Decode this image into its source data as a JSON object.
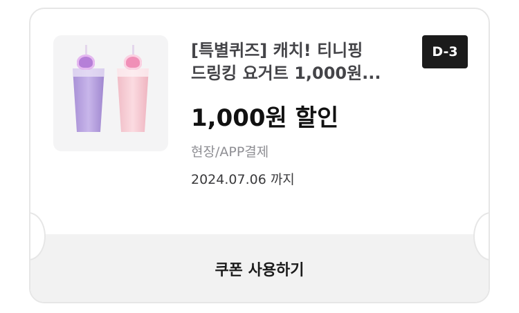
{
  "coupon": {
    "title_line1": "[특별퀴즈] 캐치! 티니핑",
    "title_line2": "드링킹 요거트 1,000원...",
    "dday_badge": "D-3",
    "discount": "1,000원 할인",
    "payment_method": "현장/APP결제",
    "expiry": "2024.07.06 까지",
    "use_button_label": "쿠폰 사용하기"
  },
  "colors": {
    "badge_bg": "#1b1b1b",
    "button_bg": "#f2f2f2",
    "purple_drink": "#b8a2de",
    "pink_drink": "#f6c9d1"
  },
  "icons": {
    "product_image": "two-yogurt-drink-cups-with-heart-toppers"
  }
}
